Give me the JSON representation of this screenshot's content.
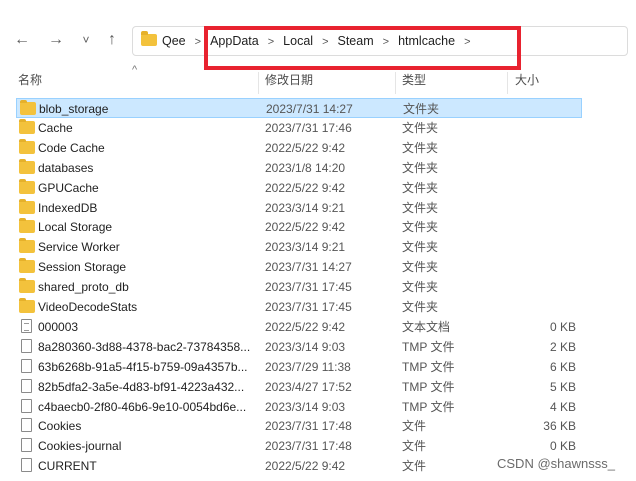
{
  "nav": {
    "back": "←",
    "forward": "→",
    "recent": "˅",
    "up": "↑"
  },
  "breadcrumbs": [
    "Qee",
    "AppData",
    "Local",
    "Steam",
    "htmlcache"
  ],
  "breadcrumb_sep": ">",
  "columns": {
    "name": "名称",
    "date": "修改日期",
    "type": "类型",
    "size": "大小"
  },
  "rows": [
    {
      "name": "blob_storage",
      "date": "2023/7/31 14:27",
      "type": "文件夹",
      "size": "",
      "icon": "folder",
      "selected": true
    },
    {
      "name": "Cache",
      "date": "2023/7/31 17:46",
      "type": "文件夹",
      "size": "",
      "icon": "folder"
    },
    {
      "name": "Code Cache",
      "date": "2022/5/22 9:42",
      "type": "文件夹",
      "size": "",
      "icon": "folder"
    },
    {
      "name": "databases",
      "date": "2023/1/8 14:20",
      "type": "文件夹",
      "size": "",
      "icon": "folder"
    },
    {
      "name": "GPUCache",
      "date": "2022/5/22 9:42",
      "type": "文件夹",
      "size": "",
      "icon": "folder"
    },
    {
      "name": "IndexedDB",
      "date": "2023/3/14 9:21",
      "type": "文件夹",
      "size": "",
      "icon": "folder"
    },
    {
      "name": "Local Storage",
      "date": "2022/5/22 9:42",
      "type": "文件夹",
      "size": "",
      "icon": "folder"
    },
    {
      "name": "Service Worker",
      "date": "2023/3/14 9:21",
      "type": "文件夹",
      "size": "",
      "icon": "folder"
    },
    {
      "name": "Session Storage",
      "date": "2023/7/31 14:27",
      "type": "文件夹",
      "size": "",
      "icon": "folder"
    },
    {
      "name": "shared_proto_db",
      "date": "2023/7/31 17:45",
      "type": "文件夹",
      "size": "",
      "icon": "folder"
    },
    {
      "name": "VideoDecodeStats",
      "date": "2023/7/31 17:45",
      "type": "文件夹",
      "size": "",
      "icon": "folder"
    },
    {
      "name": "000003",
      "date": "2022/5/22 9:42",
      "type": "文本文档",
      "size": "0 KB",
      "icon": "doc"
    },
    {
      "name": "8a280360-3d88-4378-bac2-73784358...",
      "date": "2023/3/14 9:03",
      "type": "TMP 文件",
      "size": "2 KB",
      "icon": "file"
    },
    {
      "name": "63b6268b-91a5-4f15-b759-09a4357b...",
      "date": "2023/7/29 11:38",
      "type": "TMP 文件",
      "size": "6 KB",
      "icon": "file"
    },
    {
      "name": "82b5dfa2-3a5e-4d83-bf91-4223a432...",
      "date": "2023/4/27 17:52",
      "type": "TMP 文件",
      "size": "5 KB",
      "icon": "file"
    },
    {
      "name": "c4baecb0-2f80-46b6-9e10-0054bd6e...",
      "date": "2023/3/14 9:03",
      "type": "TMP 文件",
      "size": "4 KB",
      "icon": "file"
    },
    {
      "name": "Cookies",
      "date": "2023/7/31 17:48",
      "type": "文件",
      "size": "36 KB",
      "icon": "file"
    },
    {
      "name": "Cookies-journal",
      "date": "2023/7/31 17:48",
      "type": "文件",
      "size": "0 KB",
      "icon": "file"
    },
    {
      "name": "CURRENT",
      "date": "2022/5/22 9:42",
      "type": "文件",
      "size": "",
      "icon": "file"
    }
  ],
  "watermark": "CSDN @shawnsss_",
  "colors": {
    "selection": "#cce8ff",
    "highlight_box": "#e8222f",
    "folder": "#f3c23c"
  }
}
